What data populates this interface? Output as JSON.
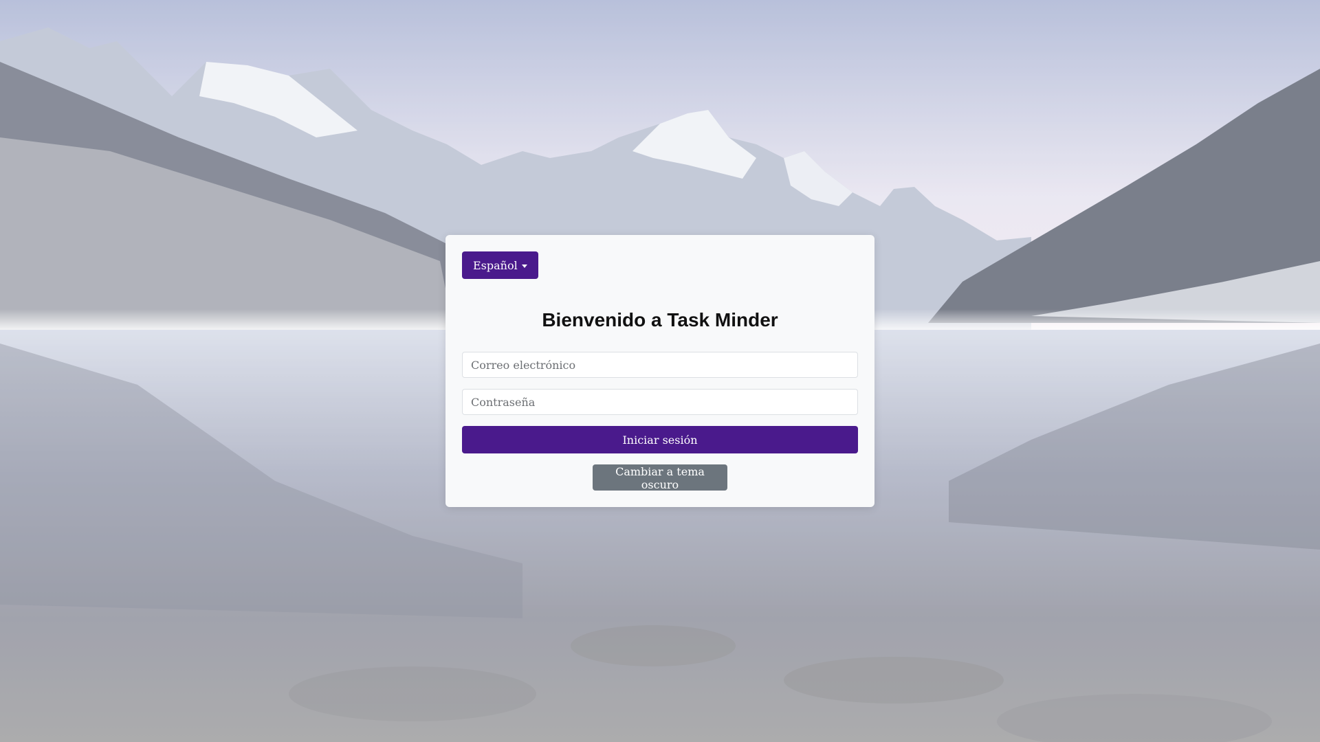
{
  "app": {
    "title": "Bienvenido a Task Minder"
  },
  "language": {
    "selected": "Español",
    "icon": "caret-down-icon"
  },
  "form": {
    "email_placeholder": "Correo electrónico",
    "email_value": "",
    "password_placeholder": "Contraseña",
    "password_value": "",
    "login_label": "Iniciar sesión",
    "theme_toggle_label": "Cambiar a tema oscuro"
  },
  "colors": {
    "primary": "#4a1a8c",
    "secondary": "#6c757d",
    "card_background": "#f8f9fa"
  }
}
